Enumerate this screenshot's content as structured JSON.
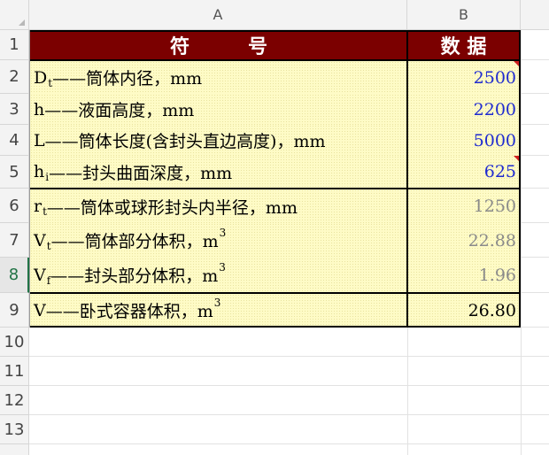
{
  "columns": [
    "A",
    "B"
  ],
  "rows": [
    "1",
    "2",
    "3",
    "4",
    "5",
    "6",
    "7",
    "8",
    "9",
    "10",
    "11",
    "12",
    "13"
  ],
  "header": {
    "symbol": "符　　　号",
    "value": "数 据"
  },
  "table": [
    {
      "sym": "D",
      "sub": "t",
      "sup": "",
      "desc": "——筒体内径，mm",
      "value": "2500"
    },
    {
      "sym": "h",
      "sub": "",
      "sup": "",
      "desc": "——液面高度，mm",
      "value": "2200"
    },
    {
      "sym": "L",
      "sub": "",
      "sup": "",
      "desc": "——筒体长度(含封头直边高度)，mm",
      "value": "5000"
    },
    {
      "sym": "h",
      "sub": "i",
      "sup": "",
      "desc": "——封头曲面深度，mm",
      "value": "625"
    },
    {
      "sym": "r",
      "sub": "t",
      "sup": "",
      "desc": "——筒体或球形封头内半径，mm",
      "value": "1250"
    },
    {
      "sym": "V",
      "sub": "t",
      "sup": "3",
      "desc": "——筒体部分体积，m",
      "value": "22.88"
    },
    {
      "sym": "V",
      "sub": "f",
      "sup": "3",
      "desc": "——封头部分体积，m",
      "value": "1.96"
    },
    {
      "sym": "V",
      "sub": "",
      "sup": "3",
      "desc": "——卧式容器体积，m",
      "value": "26.80"
    }
  ],
  "colors": {
    "header_bg": "#7b0000",
    "cell_bg": "#fefbc6",
    "input_value": "#1f2bd1",
    "computed_value": "#8a8a8a",
    "selected_row": "#217346"
  }
}
